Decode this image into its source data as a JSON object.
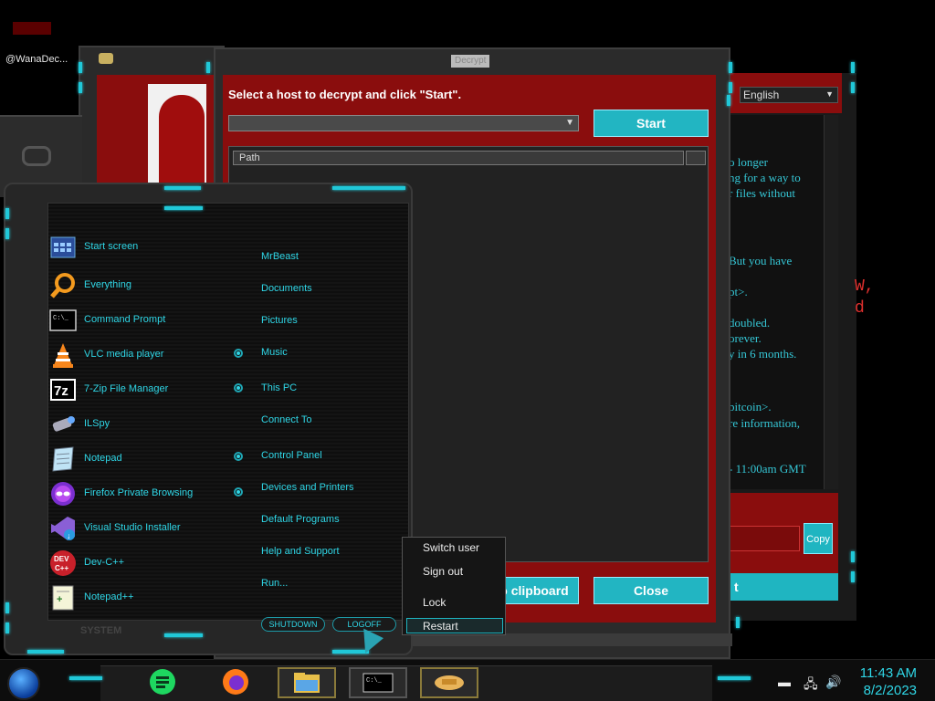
{
  "desktop": {
    "icon_label": "@WanaDec..."
  },
  "decrypt_dialog": {
    "title": "Decrypt",
    "prompt": "Select a host to decrypt and click \"Start\".",
    "host_value": "",
    "start_label": "Start",
    "column_path": "Path",
    "copy_clipboard_label": "Copy to clipboard",
    "copy_clipboard_visible": "o clipboard",
    "close_label": "Close"
  },
  "ransom_window": {
    "language": "English",
    "text_lines": [
      "o longer",
      "ng for a way to",
      "r files without",
      "But you have",
      "pt>.",
      "doubled.",
      "orever.",
      "y in 6 months.",
      "bitcoin>.",
      "re information,",
      " - 11:00am GMT"
    ],
    "copy_label": "Copy",
    "check_label": "t",
    "red_fragments": [
      "W,",
      "d"
    ]
  },
  "start_menu": {
    "programs": [
      {
        "label": "Start screen",
        "icon": "start-screen-icon"
      },
      {
        "label": "Everything",
        "icon": "everything-icon"
      },
      {
        "label": "Command Prompt",
        "icon": "command-prompt-icon"
      },
      {
        "label": "VLC media player",
        "icon": "vlc-icon"
      },
      {
        "label": "7-Zip File Manager",
        "icon": "7zip-icon"
      },
      {
        "label": "ILSpy",
        "icon": "ilspy-icon"
      },
      {
        "label": "Notepad",
        "icon": "notepad-icon"
      },
      {
        "label": "Firefox Private Browsing",
        "icon": "firefox-private-icon"
      },
      {
        "label": "Visual Studio Installer",
        "icon": "vs-installer-icon"
      },
      {
        "label": "Dev-C++",
        "icon": "devcpp-icon"
      },
      {
        "label": "Notepad++",
        "icon": "notepadpp-icon"
      }
    ],
    "places": [
      {
        "label": "MrBeast",
        "bullet": false
      },
      {
        "label": "Documents",
        "bullet": false
      },
      {
        "label": "Pictures",
        "bullet": false
      },
      {
        "label": "Music",
        "bullet": true
      },
      {
        "label": "This PC",
        "bullet": true
      },
      {
        "label": "Connect To",
        "bullet": false
      },
      {
        "label": "Control Panel",
        "bullet": true
      },
      {
        "label": "Devices and Printers",
        "bullet": true
      },
      {
        "label": "Default Programs",
        "bullet": false
      },
      {
        "label": "Help and Support",
        "bullet": false
      },
      {
        "label": "Run...",
        "bullet": false
      }
    ],
    "system_label": "SYSTEM",
    "shutdown_label": "SHUTDOWN",
    "logoff_label": "LOGOFF"
  },
  "power_menu": {
    "items": [
      "Switch user",
      "Sign out",
      "Lock",
      "Restart"
    ],
    "selected": "Restart"
  },
  "taskbar": {
    "time": "11:43 AM",
    "date": "8/2/2023"
  },
  "colors": {
    "accent": "#1fb5c1",
    "window_red": "#8a0d0d",
    "link_cyan": "#2fd6e6"
  }
}
